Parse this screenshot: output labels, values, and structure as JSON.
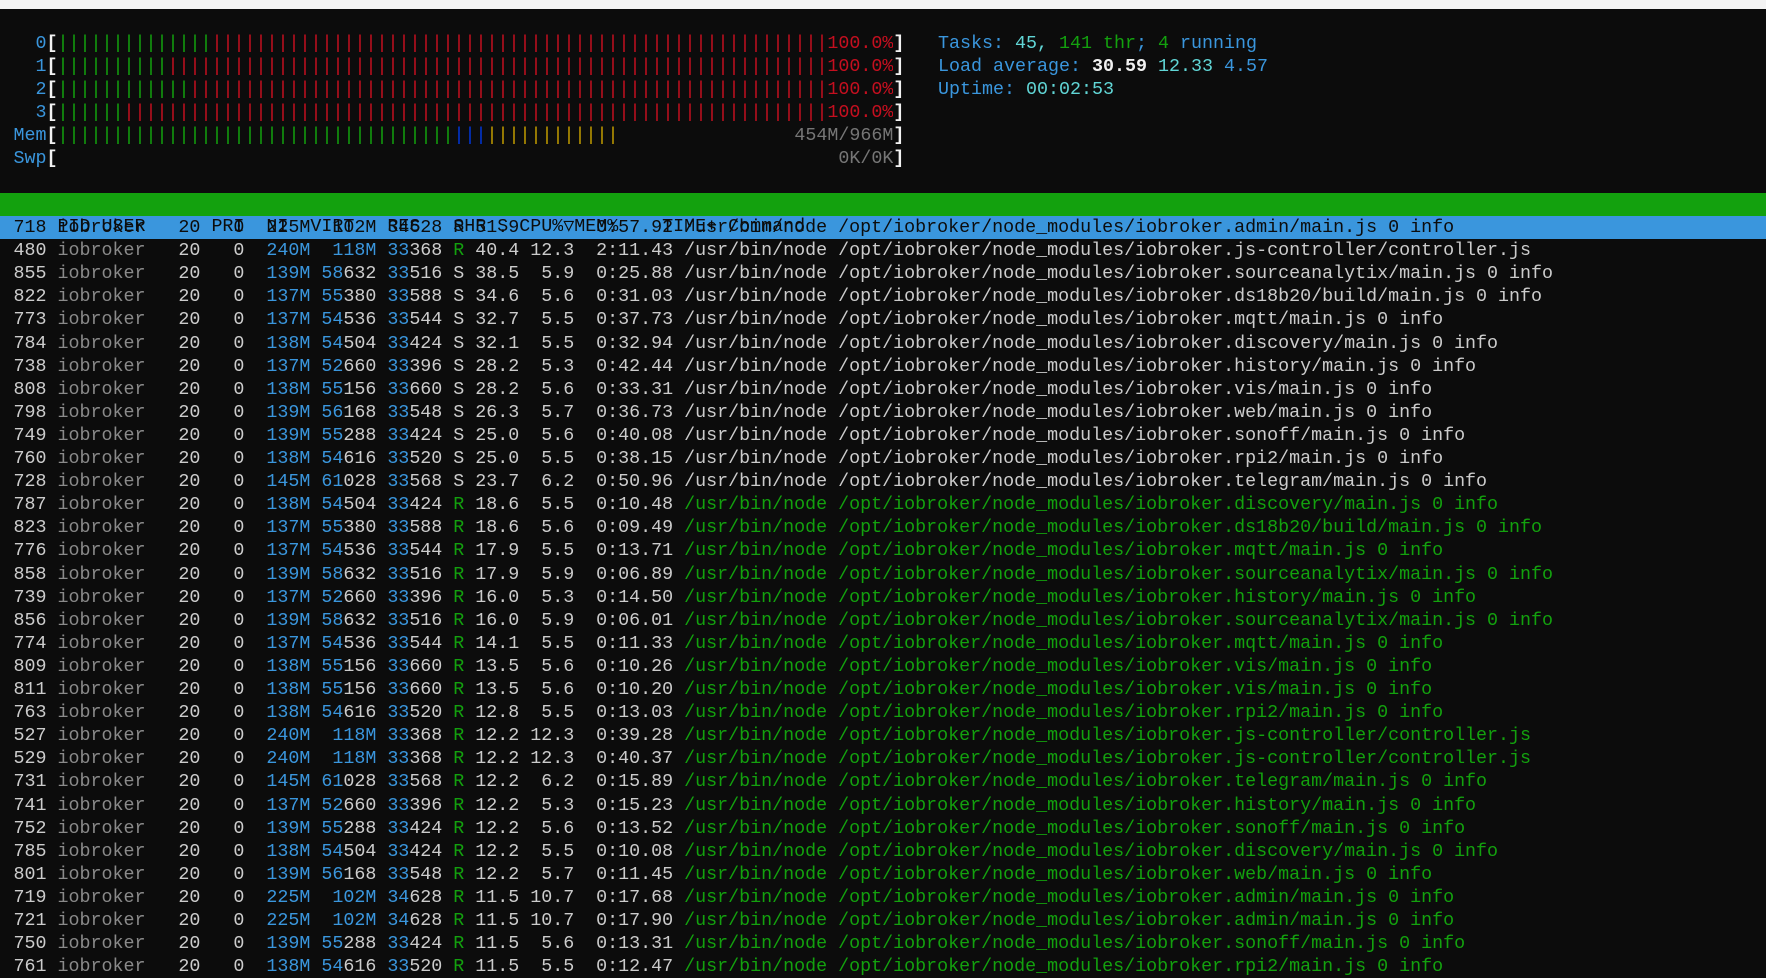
{
  "meters": [
    {
      "label": "0",
      "segments": [
        {
          "color": "#13a10e",
          "count": 14
        },
        {
          "color": "#c50f1f",
          "count": 56
        }
      ],
      "text": "100.0%",
      "text_color": "#c50f1f"
    },
    {
      "label": "1",
      "segments": [
        {
          "color": "#13a10e",
          "count": 10
        },
        {
          "color": "#c50f1f",
          "count": 60
        }
      ],
      "text": "100.0%",
      "text_color": "#c50f1f"
    },
    {
      "label": "2",
      "segments": [
        {
          "color": "#13a10e",
          "count": 12
        },
        {
          "color": "#c50f1f",
          "count": 58
        }
      ],
      "text": "100.0%",
      "text_color": "#c50f1f"
    },
    {
      "label": "3",
      "segments": [
        {
          "color": "#13a10e",
          "count": 6
        },
        {
          "color": "#c50f1f",
          "count": 64
        }
      ],
      "text": "100.0%",
      "text_color": "#c50f1f"
    },
    {
      "label": "Mem",
      "segments": [
        {
          "color": "#13a10e",
          "count": 36
        },
        {
          "color": "#0037da",
          "count": 3
        },
        {
          "color": "#c19c00",
          "count": 12
        }
      ],
      "text": "454M/966M",
      "text_color": "#767676"
    },
    {
      "label": "Swp",
      "segments": [],
      "text": "0K/0K",
      "text_color": "#767676"
    }
  ],
  "bracket_open": "[",
  "bracket_close": "]",
  "bar_char": "|",
  "info": {
    "tasks_label": "Tasks: ",
    "tasks_count": "45, ",
    "threads": "141 thr",
    "sep": "; ",
    "running_count": "4",
    "running_label": " running",
    "load_label": "Load average: ",
    "load1": "30.59",
    "load5": "12.33",
    "load15": "4.57",
    "uptime_label": "Uptime: ",
    "uptime": "00:02:53"
  },
  "columns": {
    "pid": "PID",
    "user": "USER",
    "pri": "PRI",
    "ni": "NI",
    "virt": "VIRT",
    "res": "RES",
    "shr": "SHR",
    "s": "S",
    "cpu": "CPU%",
    "sort_icon": "▽",
    "mem": "MEM%",
    "time": "TIME+",
    "command": "Command"
  },
  "processes": [
    {
      "pid": "718",
      "user": "iobroker",
      "pri": "20",
      "ni": "0",
      "virt": "225M",
      "res": "102M",
      "shr": "34628",
      "s": "R",
      "cpu": "51.9",
      "mem": "10.7",
      "time": "0:57.92",
      "command": "/usr/bin/node /opt/iobroker/node_modules/iobroker.admin/main.js 0 info",
      "thread": false,
      "selected": true
    },
    {
      "pid": "480",
      "user": "iobroker",
      "pri": "20",
      "ni": "0",
      "virt": "240M",
      "res": "118M",
      "shr": "33368",
      "s": "R",
      "cpu": "40.4",
      "mem": "12.3",
      "time": "2:11.43",
      "command": "/usr/bin/node /opt/iobroker/node_modules/iobroker.js-controller/controller.js",
      "thread": false
    },
    {
      "pid": "855",
      "user": "iobroker",
      "pri": "20",
      "ni": "0",
      "virt": "139M",
      "res": "58632",
      "shr": "33516",
      "s": "S",
      "cpu": "38.5",
      "mem": "5.9",
      "time": "0:25.88",
      "command": "/usr/bin/node /opt/iobroker/node_modules/iobroker.sourceanalytix/main.js 0 info",
      "thread": false
    },
    {
      "pid": "822",
      "user": "iobroker",
      "pri": "20",
      "ni": "0",
      "virt": "137M",
      "res": "55380",
      "shr": "33588",
      "s": "S",
      "cpu": "34.6",
      "mem": "5.6",
      "time": "0:31.03",
      "command": "/usr/bin/node /opt/iobroker/node_modules/iobroker.ds18b20/build/main.js 0 info",
      "thread": false
    },
    {
      "pid": "773",
      "user": "iobroker",
      "pri": "20",
      "ni": "0",
      "virt": "137M",
      "res": "54536",
      "shr": "33544",
      "s": "S",
      "cpu": "32.7",
      "mem": "5.5",
      "time": "0:37.73",
      "command": "/usr/bin/node /opt/iobroker/node_modules/iobroker.mqtt/main.js 0 info",
      "thread": false
    },
    {
      "pid": "784",
      "user": "iobroker",
      "pri": "20",
      "ni": "0",
      "virt": "138M",
      "res": "54504",
      "shr": "33424",
      "s": "S",
      "cpu": "32.1",
      "mem": "5.5",
      "time": "0:32.94",
      "command": "/usr/bin/node /opt/iobroker/node_modules/iobroker.discovery/main.js 0 info",
      "thread": false
    },
    {
      "pid": "738",
      "user": "iobroker",
      "pri": "20",
      "ni": "0",
      "virt": "137M",
      "res": "52660",
      "shr": "33396",
      "s": "S",
      "cpu": "28.2",
      "mem": "5.3",
      "time": "0:42.44",
      "command": "/usr/bin/node /opt/iobroker/node_modules/iobroker.history/main.js 0 info",
      "thread": false
    },
    {
      "pid": "808",
      "user": "iobroker",
      "pri": "20",
      "ni": "0",
      "virt": "138M",
      "res": "55156",
      "shr": "33660",
      "s": "S",
      "cpu": "28.2",
      "mem": "5.6",
      "time": "0:33.31",
      "command": "/usr/bin/node /opt/iobroker/node_modules/iobroker.vis/main.js 0 info",
      "thread": false
    },
    {
      "pid": "798",
      "user": "iobroker",
      "pri": "20",
      "ni": "0",
      "virt": "139M",
      "res": "56168",
      "shr": "33548",
      "s": "S",
      "cpu": "26.3",
      "mem": "5.7",
      "time": "0:36.73",
      "command": "/usr/bin/node /opt/iobroker/node_modules/iobroker.web/main.js 0 info",
      "thread": false
    },
    {
      "pid": "749",
      "user": "iobroker",
      "pri": "20",
      "ni": "0",
      "virt": "139M",
      "res": "55288",
      "shr": "33424",
      "s": "S",
      "cpu": "25.0",
      "mem": "5.6",
      "time": "0:40.08",
      "command": "/usr/bin/node /opt/iobroker/node_modules/iobroker.sonoff/main.js 0 info",
      "thread": false
    },
    {
      "pid": "760",
      "user": "iobroker",
      "pri": "20",
      "ni": "0",
      "virt": "138M",
      "res": "54616",
      "shr": "33520",
      "s": "S",
      "cpu": "25.0",
      "mem": "5.5",
      "time": "0:38.15",
      "command": "/usr/bin/node /opt/iobroker/node_modules/iobroker.rpi2/main.js 0 info",
      "thread": false
    },
    {
      "pid": "728",
      "user": "iobroker",
      "pri": "20",
      "ni": "0",
      "virt": "145M",
      "res": "61028",
      "shr": "33568",
      "s": "S",
      "cpu": "23.7",
      "mem": "6.2",
      "time": "0:50.96",
      "command": "/usr/bin/node /opt/iobroker/node_modules/iobroker.telegram/main.js 0 info",
      "thread": false
    },
    {
      "pid": "787",
      "user": "iobroker",
      "pri": "20",
      "ni": "0",
      "virt": "138M",
      "res": "54504",
      "shr": "33424",
      "s": "R",
      "cpu": "18.6",
      "mem": "5.5",
      "time": "0:10.48",
      "command": "/usr/bin/node /opt/iobroker/node_modules/iobroker.discovery/main.js 0 info",
      "thread": true
    },
    {
      "pid": "823",
      "user": "iobroker",
      "pri": "20",
      "ni": "0",
      "virt": "137M",
      "res": "55380",
      "shr": "33588",
      "s": "R",
      "cpu": "18.6",
      "mem": "5.6",
      "time": "0:09.49",
      "command": "/usr/bin/node /opt/iobroker/node_modules/iobroker.ds18b20/build/main.js 0 info",
      "thread": true
    },
    {
      "pid": "776",
      "user": "iobroker",
      "pri": "20",
      "ni": "0",
      "virt": "137M",
      "res": "54536",
      "shr": "33544",
      "s": "R",
      "cpu": "17.9",
      "mem": "5.5",
      "time": "0:13.71",
      "command": "/usr/bin/node /opt/iobroker/node_modules/iobroker.mqtt/main.js 0 info",
      "thread": true
    },
    {
      "pid": "858",
      "user": "iobroker",
      "pri": "20",
      "ni": "0",
      "virt": "139M",
      "res": "58632",
      "shr": "33516",
      "s": "R",
      "cpu": "17.9",
      "mem": "5.9",
      "time": "0:06.89",
      "command": "/usr/bin/node /opt/iobroker/node_modules/iobroker.sourceanalytix/main.js 0 info",
      "thread": true
    },
    {
      "pid": "739",
      "user": "iobroker",
      "pri": "20",
      "ni": "0",
      "virt": "137M",
      "res": "52660",
      "shr": "33396",
      "s": "R",
      "cpu": "16.0",
      "mem": "5.3",
      "time": "0:14.50",
      "command": "/usr/bin/node /opt/iobroker/node_modules/iobroker.history/main.js 0 info",
      "thread": true
    },
    {
      "pid": "856",
      "user": "iobroker",
      "pri": "20",
      "ni": "0",
      "virt": "139M",
      "res": "58632",
      "shr": "33516",
      "s": "R",
      "cpu": "16.0",
      "mem": "5.9",
      "time": "0:06.01",
      "command": "/usr/bin/node /opt/iobroker/node_modules/iobroker.sourceanalytix/main.js 0 info",
      "thread": true
    },
    {
      "pid": "774",
      "user": "iobroker",
      "pri": "20",
      "ni": "0",
      "virt": "137M",
      "res": "54536",
      "shr": "33544",
      "s": "R",
      "cpu": "14.1",
      "mem": "5.5",
      "time": "0:11.33",
      "command": "/usr/bin/node /opt/iobroker/node_modules/iobroker.mqtt/main.js 0 info",
      "thread": true
    },
    {
      "pid": "809",
      "user": "iobroker",
      "pri": "20",
      "ni": "0",
      "virt": "138M",
      "res": "55156",
      "shr": "33660",
      "s": "R",
      "cpu": "13.5",
      "mem": "5.6",
      "time": "0:10.26",
      "command": "/usr/bin/node /opt/iobroker/node_modules/iobroker.vis/main.js 0 info",
      "thread": true
    },
    {
      "pid": "811",
      "user": "iobroker",
      "pri": "20",
      "ni": "0",
      "virt": "138M",
      "res": "55156",
      "shr": "33660",
      "s": "R",
      "cpu": "13.5",
      "mem": "5.6",
      "time": "0:10.20",
      "command": "/usr/bin/node /opt/iobroker/node_modules/iobroker.vis/main.js 0 info",
      "thread": true
    },
    {
      "pid": "763",
      "user": "iobroker",
      "pri": "20",
      "ni": "0",
      "virt": "138M",
      "res": "54616",
      "shr": "33520",
      "s": "R",
      "cpu": "12.8",
      "mem": "5.5",
      "time": "0:13.03",
      "command": "/usr/bin/node /opt/iobroker/node_modules/iobroker.rpi2/main.js 0 info",
      "thread": true
    },
    {
      "pid": "527",
      "user": "iobroker",
      "pri": "20",
      "ni": "0",
      "virt": "240M",
      "res": "118M",
      "shr": "33368",
      "s": "R",
      "cpu": "12.2",
      "mem": "12.3",
      "time": "0:39.28",
      "command": "/usr/bin/node /opt/iobroker/node_modules/iobroker.js-controller/controller.js",
      "thread": true
    },
    {
      "pid": "529",
      "user": "iobroker",
      "pri": "20",
      "ni": "0",
      "virt": "240M",
      "res": "118M",
      "shr": "33368",
      "s": "R",
      "cpu": "12.2",
      "mem": "12.3",
      "time": "0:40.37",
      "command": "/usr/bin/node /opt/iobroker/node_modules/iobroker.js-controller/controller.js",
      "thread": true
    },
    {
      "pid": "731",
      "user": "iobroker",
      "pri": "20",
      "ni": "0",
      "virt": "145M",
      "res": "61028",
      "shr": "33568",
      "s": "R",
      "cpu": "12.2",
      "mem": "6.2",
      "time": "0:15.89",
      "command": "/usr/bin/node /opt/iobroker/node_modules/iobroker.telegram/main.js 0 info",
      "thread": true
    },
    {
      "pid": "741",
      "user": "iobroker",
      "pri": "20",
      "ni": "0",
      "virt": "137M",
      "res": "52660",
      "shr": "33396",
      "s": "R",
      "cpu": "12.2",
      "mem": "5.3",
      "time": "0:15.23",
      "command": "/usr/bin/node /opt/iobroker/node_modules/iobroker.history/main.js 0 info",
      "thread": true
    },
    {
      "pid": "752",
      "user": "iobroker",
      "pri": "20",
      "ni": "0",
      "virt": "139M",
      "res": "55288",
      "shr": "33424",
      "s": "R",
      "cpu": "12.2",
      "mem": "5.6",
      "time": "0:13.52",
      "command": "/usr/bin/node /opt/iobroker/node_modules/iobroker.sonoff/main.js 0 info",
      "thread": true
    },
    {
      "pid": "785",
      "user": "iobroker",
      "pri": "20",
      "ni": "0",
      "virt": "138M",
      "res": "54504",
      "shr": "33424",
      "s": "R",
      "cpu": "12.2",
      "mem": "5.5",
      "time": "0:10.08",
      "command": "/usr/bin/node /opt/iobroker/node_modules/iobroker.discovery/main.js 0 info",
      "thread": true
    },
    {
      "pid": "801",
      "user": "iobroker",
      "pri": "20",
      "ni": "0",
      "virt": "139M",
      "res": "56168",
      "shr": "33548",
      "s": "R",
      "cpu": "12.2",
      "mem": "5.7",
      "time": "0:11.45",
      "command": "/usr/bin/node /opt/iobroker/node_modules/iobroker.web/main.js 0 info",
      "thread": true
    },
    {
      "pid": "719",
      "user": "iobroker",
      "pri": "20",
      "ni": "0",
      "virt": "225M",
      "res": "102M",
      "shr": "34628",
      "s": "R",
      "cpu": "11.5",
      "mem": "10.7",
      "time": "0:17.68",
      "command": "/usr/bin/node /opt/iobroker/node_modules/iobroker.admin/main.js 0 info",
      "thread": true
    },
    {
      "pid": "721",
      "user": "iobroker",
      "pri": "20",
      "ni": "0",
      "virt": "225M",
      "res": "102M",
      "shr": "34628",
      "s": "R",
      "cpu": "11.5",
      "mem": "10.7",
      "time": "0:17.90",
      "command": "/usr/bin/node /opt/iobroker/node_modules/iobroker.admin/main.js 0 info",
      "thread": true
    },
    {
      "pid": "750",
      "user": "iobroker",
      "pri": "20",
      "ni": "0",
      "virt": "139M",
      "res": "55288",
      "shr": "33424",
      "s": "R",
      "cpu": "11.5",
      "mem": "5.6",
      "time": "0:13.31",
      "command": "/usr/bin/node /opt/iobroker/node_modules/iobroker.sonoff/main.js 0 info",
      "thread": true
    },
    {
      "pid": "761",
      "user": "iobroker",
      "pri": "20",
      "ni": "0",
      "virt": "138M",
      "res": "54616",
      "shr": "33520",
      "s": "R",
      "cpu": "11.5",
      "mem": "5.5",
      "time": "0:12.47",
      "command": "/usr/bin/node /opt/iobroker/node_modules/iobroker.rpi2/main.js 0 info",
      "thread": true
    }
  ]
}
